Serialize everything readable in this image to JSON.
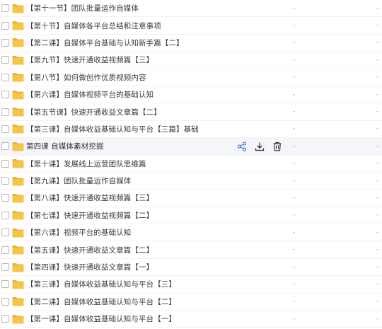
{
  "colors": {
    "folder": "#f6c548",
    "folder_tab": "#e9b234",
    "hover_row": "#f4f6fa"
  },
  "icons": {
    "folder": "folder-icon",
    "share": "share-icon",
    "download": "download-icon",
    "delete": "trash-icon"
  },
  "placeholder": "-",
  "rows": [
    {
      "name": "【第十一节】团队批量运作自媒体"
    },
    {
      "name": "【第十节】自媒体各平台总结和注意事项"
    },
    {
      "name": "【第二课】自媒体平台基础与认知新手篇【二】"
    },
    {
      "name": "【第九节】快速开通收益视频篇【三】"
    },
    {
      "name": "【第八节】如何做创作优质视频内容"
    },
    {
      "name": "【第六课】自媒体视频平台的基础认知"
    },
    {
      "name": "【第五节课】快速开通收益文章篇【二】"
    },
    {
      "name": "【第三课】自媒体收益基础认知与平台【三篇】基础"
    },
    {
      "name": "第四课 自媒体素材挖掘"
    },
    {
      "name": "【第十课】发展线上运营团队思维篇"
    },
    {
      "name": "【第九课】团队批量运作自媒体"
    },
    {
      "name": "【第八课】快速开通收益视频篇【三】"
    },
    {
      "name": "【第七课】快速开通收益视频篇【二】"
    },
    {
      "name": "【第六课】视频平台的基础认知"
    },
    {
      "name": "【第五课】快速开通收益文章篇【二】"
    },
    {
      "name": "【第四课】快速开通收益文章篇【一】"
    },
    {
      "name": "【第三课】自媒体收益基础认知与平台【三】"
    },
    {
      "name": "【第二课】自媒体收益基础认知与平台【二】"
    },
    {
      "name": "【第一课】自媒体收益基础认知与平台【一】"
    }
  ]
}
